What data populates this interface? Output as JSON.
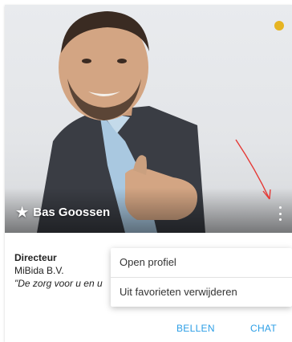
{
  "contact": {
    "name": "Bas Goossen",
    "role": "Directeur",
    "company": "MiBida B.V.",
    "quote": "\"De zorg voor u en u"
  },
  "menu": {
    "items": [
      {
        "label": "Open profiel"
      },
      {
        "label": "Uit favorieten verwijderen"
      }
    ]
  },
  "actions": {
    "call_label": "BELLEN",
    "chat_label": "CHAT"
  },
  "icons": {
    "favorite": "star-icon",
    "more": "kebab-menu-icon",
    "status": "status-dot"
  },
  "colors": {
    "accent": "#2b9ee6",
    "status": "#e6b422",
    "annotation": "#e53935"
  }
}
